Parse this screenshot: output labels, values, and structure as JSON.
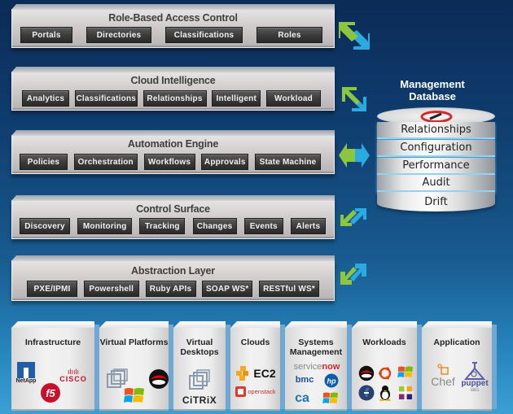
{
  "layers": [
    {
      "title": "Role-Based Access Control",
      "items": [
        "Portals",
        "Directories",
        "Classifications",
        "Roles"
      ]
    },
    {
      "title": "Cloud Intelligence",
      "items": [
        "Analytics",
        "Classifications",
        "Relationships",
        "Intelligent",
        "Workload"
      ]
    },
    {
      "title": "Automation Engine",
      "items": [
        "Policies",
        "Orchestration",
        "Workflows",
        "Approvals",
        "State Machine"
      ]
    },
    {
      "title": "Control Surface",
      "items": [
        "Discovery",
        "Monitoring",
        "Tracking",
        "Changes",
        "Events",
        "Alerts"
      ]
    },
    {
      "title": "Abstraction Layer",
      "items": [
        "PXE/IPMI",
        "Powershell",
        "Ruby APIs",
        "SOAP WS*",
        "RESTful WS*"
      ]
    }
  ],
  "database": {
    "title_line1": "Management",
    "title_line2": "Database",
    "tiers": [
      "Relationships",
      "Configuration",
      "Performance",
      "Audit",
      "Drift"
    ]
  },
  "providers": [
    {
      "title": "Infrastructure",
      "logos": [
        "NetApp",
        "CISCO",
        "f5"
      ]
    },
    {
      "title": "Virtual Platforms",
      "logos": [
        "vmware",
        "windows",
        "redhat"
      ]
    },
    {
      "title": "Virtual Desktops",
      "logos": [
        "vmware",
        "CITRIX"
      ]
    },
    {
      "title": "Clouds",
      "logos": [
        "EC2",
        "openstack"
      ]
    },
    {
      "title": "Systems Management",
      "logos": [
        "servicenow",
        "bmc",
        "hp",
        "ca",
        "windows"
      ]
    },
    {
      "title": "Workloads",
      "logos": [
        "redhat",
        "ubuntu",
        "windows",
        "fedora",
        "linux",
        "centos"
      ]
    },
    {
      "title": "Application",
      "logos": [
        "Chef",
        "puppet labs"
      ]
    }
  ],
  "logo_text": {
    "netapp": "NetApp",
    "cisco_bars": "ılıılı",
    "cisco": "CISCO",
    "f5": "f5",
    "citrix": "CiTRiX",
    "ec2": "EC2",
    "openstack": "openstack",
    "servicenow_a": "service",
    "servicenow_b": "now",
    "bmc": "bmc",
    "hp": "hp",
    "ca": "ca",
    "chef": "Chef",
    "puppet": "puppet",
    "puppet_sub": "labs"
  },
  "colors": {
    "arrow_green": "#8cc63f",
    "arrow_blue": "#29abe2",
    "chip_bg": "#3a3a3a",
    "panel_bg": "#cfcccb"
  }
}
